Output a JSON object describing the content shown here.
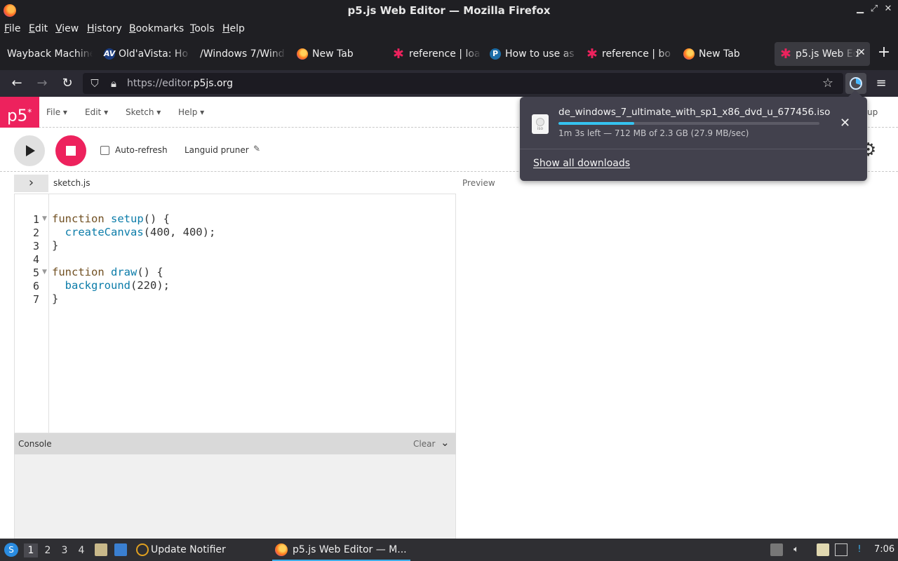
{
  "window": {
    "title": "p5.js Web Editor — Mozilla Firefox"
  },
  "menubar": [
    "File",
    "Edit",
    "View",
    "History",
    "Bookmarks",
    "Tools",
    "Help"
  ],
  "tabs": [
    {
      "label": "Wayback Machine",
      "icon": "none"
    },
    {
      "label": "Old'aVista: Ho",
      "icon": "oldavista-icon"
    },
    {
      "label": "/Windows 7/Wind",
      "icon": "none"
    },
    {
      "label": "New Tab",
      "icon": "firefox-icon"
    },
    {
      "label": "reference | loa",
      "icon": "p5-star-icon"
    },
    {
      "label": "How to use as",
      "icon": "p-icon"
    },
    {
      "label": "reference | bo",
      "icon": "p5-star-icon"
    },
    {
      "label": "New Tab",
      "icon": "firefox-icon"
    },
    {
      "label": "p5.js Web Ed",
      "icon": "p5-star-icon",
      "active": true
    }
  ],
  "navbar": {
    "url_prefix": "https://editor.",
    "url_domain": "p5js.org"
  },
  "p5": {
    "logo": "p5",
    "menus": [
      "File",
      "Edit",
      "Sketch",
      "Help"
    ],
    "login_partial": "up",
    "auto_refresh_label": "Auto-refresh",
    "sketch_name": "Languid pruner",
    "file_name": "sketch.js",
    "preview_label": "Preview",
    "code_lines": [
      "function setup() {",
      "  createCanvas(400, 400);",
      "}",
      "",
      "function draw() {",
      "  background(220);",
      "}"
    ],
    "console_label": "Console",
    "console_clear": "Clear"
  },
  "download": {
    "filename": "de_windows_7_ultimate_with_sp1_x86_dvd_u_677456.iso",
    "status": "1m 3s left — 712 MB of 2.3 GB (27.9 MB/sec)",
    "progress_fraction": 0.29,
    "show_all": "Show all downloads",
    "file_ext": "iso"
  },
  "taskbar": {
    "workspaces": [
      "1",
      "2",
      "3",
      "4"
    ],
    "tasks": [
      {
        "label": "Update Notifier"
      },
      {
        "label": "p5.js Web Editor — M...",
        "active": true
      }
    ],
    "clock": "7:06"
  },
  "colors": {
    "p5_pink": "#ed225d",
    "progress": "#35c3f0",
    "chrome_dark": "#1f1f23"
  }
}
